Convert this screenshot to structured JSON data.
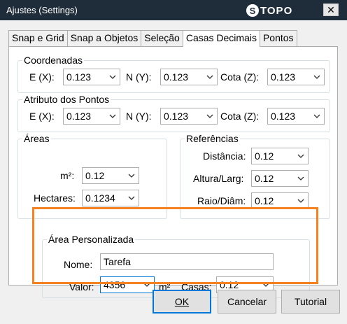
{
  "window": {
    "title": "Ajustes  (Settings)",
    "logo_mark": "S",
    "logo_text": "TOPO",
    "close_glyph": "✕"
  },
  "tabs": [
    {
      "label": "Snap e Grid",
      "active": false
    },
    {
      "label": "Snap a Objetos",
      "active": false
    },
    {
      "label": "Seleção",
      "active": false
    },
    {
      "label": "Casas Decimais",
      "active": true
    },
    {
      "label": "Pontos",
      "active": false
    }
  ],
  "coordenadas": {
    "title": "Coordenadas",
    "e_label": "E (X):",
    "e_value": "0.123",
    "n_label": "N (Y):",
    "n_value": "0.123",
    "cota_label": "Cota (Z):",
    "cota_value": "0.123"
  },
  "atributo": {
    "title": "Atributo dos Pontos",
    "e_label": "E (X):",
    "e_value": "0.123",
    "n_label": "N (Y):",
    "n_value": "0.123",
    "cota_label": "Cota (Z):",
    "cota_value": "0.123"
  },
  "areas": {
    "title": "Áreas",
    "m2_label": "m²:",
    "m2_value": "0.12",
    "hectares_label": "Hectares:",
    "hectares_value": "0.1234"
  },
  "referencias": {
    "title": "Referências",
    "distancia_label": "Distância:",
    "distancia_value": "0.12",
    "altura_label": "Altura/Larg:",
    "altura_value": "0.12",
    "raio_label": "Raio/Diâm:",
    "raio_value": "0.12"
  },
  "area_personalizada": {
    "title": "Área Personalizada",
    "nome_label": "Nome:",
    "nome_value": "Tarefa",
    "valor_label": "Valor:",
    "valor_value": "4356",
    "unit_label": "m²",
    "casas_label": "Casas:",
    "casas_value": "0.12",
    "highlight_color": "#f58220"
  },
  "buttons": {
    "ok": "OK",
    "cancelar": "Cancelar",
    "tutorial": "Tutorial"
  },
  "colors": {
    "titlebar": "#1f2d3a",
    "focus": "#0078d7"
  }
}
